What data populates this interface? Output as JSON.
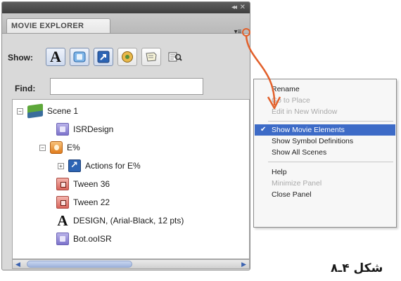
{
  "panel": {
    "title": "MOVIE EXPLORER",
    "titlebar_controls": {
      "collapse": "◂◂",
      "close": "✕"
    },
    "menu_button": "▾≡",
    "show_label": "Show:",
    "show_buttons": [
      {
        "icon": "text-icon",
        "label": "A"
      },
      {
        "icon": "buttons-movieclips-graphics-icon",
        "label": ""
      },
      {
        "icon": "actionscript-icon",
        "label": ""
      },
      {
        "icon": "video-sound-bitmap-icon",
        "label": ""
      },
      {
        "icon": "frames-layers-icon",
        "label": ""
      },
      {
        "icon": "customize-categories-icon",
        "label": ""
      }
    ],
    "find_label": "Find:",
    "find_value": "",
    "tree": [
      {
        "label": "Scene 1",
        "icon": "scene-icon",
        "expander": "−"
      },
      {
        "label": "ISRDesign",
        "icon": "symbol-icon"
      },
      {
        "label": "E%",
        "icon": "movieclip-icon",
        "expander": "−"
      },
      {
        "label": "Actions for E%",
        "icon": "actions-icon",
        "expander": "+"
      },
      {
        "label": "Tween 36",
        "icon": "tween-icon"
      },
      {
        "label": "Tween 22",
        "icon": "tween-icon"
      },
      {
        "label": "DESIGN, (Arial-Black, 12 pts)",
        "icon": "font-icon"
      },
      {
        "label": "Bot.ooISR",
        "icon": "symbol-icon"
      }
    ]
  },
  "context_menu": {
    "items": [
      {
        "label": "Rename",
        "state": "normal"
      },
      {
        "label": "Go to Place",
        "state": "disabled"
      },
      {
        "label": "Edit in New Window",
        "state": "disabled"
      },
      {
        "label": "Show Movie Elements",
        "state": "highlighted",
        "checked": true
      },
      {
        "label": "Show Symbol Definitions",
        "state": "normal"
      },
      {
        "label": "Show All Scenes",
        "state": "normal"
      },
      {
        "label": "Help",
        "state": "normal"
      },
      {
        "label": "Minimize Panel",
        "state": "disabled"
      },
      {
        "label": "Close Panel",
        "state": "normal"
      }
    ],
    "check_glyph": "✔"
  },
  "caption": "شکل ۴ـ۸",
  "colors": {
    "arrow": "#e2602b",
    "menu_highlight": "#3d6bc7",
    "titlebar": "#4a4a4a"
  }
}
